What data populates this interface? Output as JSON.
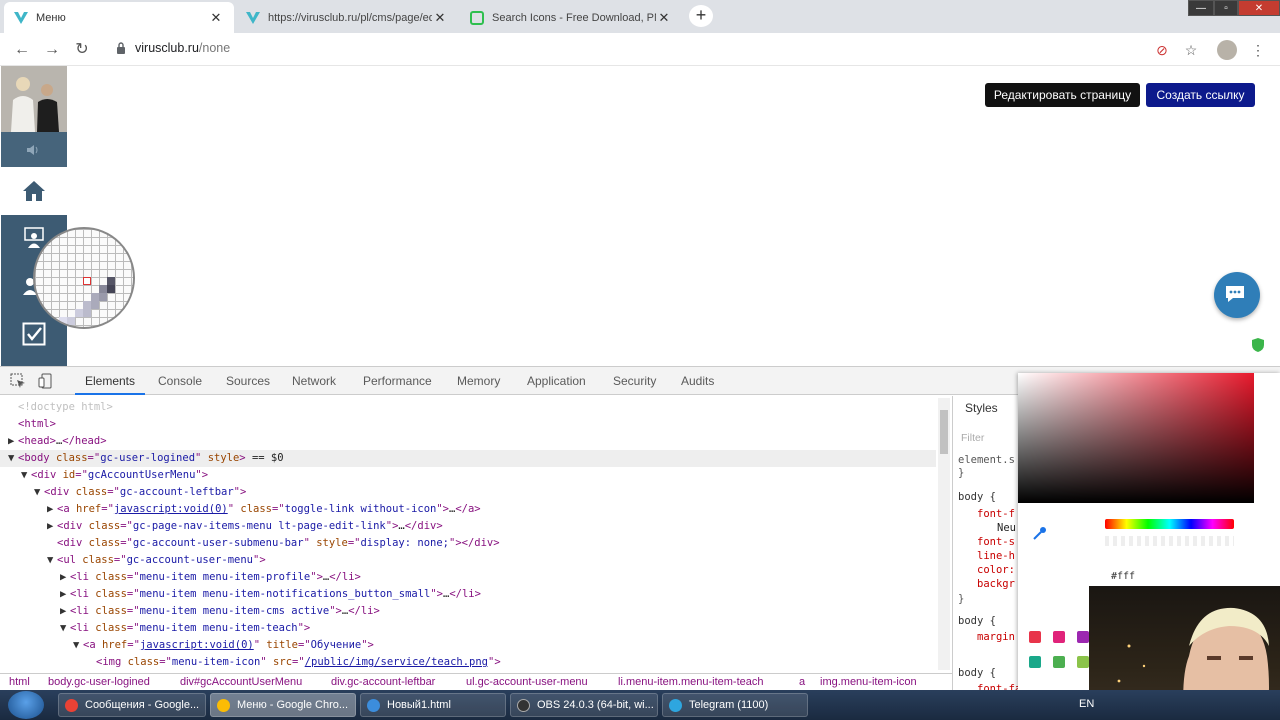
{
  "browser": {
    "tabs": [
      {
        "title": "Меню",
        "active": true
      },
      {
        "title": "https://virusclub.ru/pl/cms/page/ed",
        "active": false
      },
      {
        "title": "Search Icons - Free Download, PNG",
        "active": false
      }
    ],
    "newtab": "+",
    "close_glyph": "✕",
    "url_host": "virusclub.ru",
    "url_path": "/none"
  },
  "page": {
    "edit_button": "Редактировать страницу",
    "create_link_button": "Создать ссылку"
  },
  "devtools": {
    "tabs": [
      "Elements",
      "Console",
      "Sources",
      "Network",
      "Performance",
      "Memory",
      "Application",
      "Security",
      "Audits"
    ],
    "active_tab": "Elements",
    "dom_lines": [
      {
        "indent": 1,
        "tri": "",
        "parts": [
          [
            "doctype",
            "<!doctype html>"
          ]
        ]
      },
      {
        "indent": 1,
        "tri": "",
        "parts": [
          [
            "tag",
            "<html>"
          ]
        ]
      },
      {
        "indent": 1,
        "tri": "▶",
        "parts": [
          [
            "tag",
            "<head>"
          ],
          [
            "txt",
            "…"
          ],
          [
            "tag",
            "</head>"
          ]
        ]
      },
      {
        "indent": 1,
        "tri": "▼",
        "sel": true,
        "parts": [
          [
            "tag",
            "<body "
          ],
          [
            "attr",
            "class"
          ],
          [
            "tag",
            "=\""
          ],
          [
            "val",
            "gc-user-logined"
          ],
          [
            "tag",
            "\" "
          ],
          [
            "attr",
            "style"
          ],
          [
            "tag",
            ">"
          ],
          [
            "txt",
            " == $0"
          ]
        ]
      },
      {
        "indent": 2,
        "tri": "▼",
        "parts": [
          [
            "tag",
            "<div "
          ],
          [
            "attr",
            "id"
          ],
          [
            "tag",
            "=\""
          ],
          [
            "val",
            "gcAccountUserMenu"
          ],
          [
            "tag",
            "\">"
          ]
        ]
      },
      {
        "indent": 3,
        "tri": "▼",
        "parts": [
          [
            "tag",
            "<div "
          ],
          [
            "attr",
            "class"
          ],
          [
            "tag",
            "=\""
          ],
          [
            "val",
            "gc-account-leftbar"
          ],
          [
            "tag",
            "\">"
          ]
        ]
      },
      {
        "indent": 4,
        "tri": "▶",
        "parts": [
          [
            "tag",
            "<a "
          ],
          [
            "attr",
            "href"
          ],
          [
            "tag",
            "=\""
          ],
          [
            "lnk",
            "javascript:void(0)"
          ],
          [
            "tag",
            "\" "
          ],
          [
            "attr",
            "class"
          ],
          [
            "tag",
            "=\""
          ],
          [
            "val",
            "toggle-link without-icon"
          ],
          [
            "tag",
            "\">"
          ],
          [
            "txt",
            "…"
          ],
          [
            "tag",
            "</a>"
          ]
        ]
      },
      {
        "indent": 4,
        "tri": "▶",
        "parts": [
          [
            "tag",
            "<div "
          ],
          [
            "attr",
            "class"
          ],
          [
            "tag",
            "=\""
          ],
          [
            "val",
            "gc-page-nav-items-menu lt-page-edit-link"
          ],
          [
            "tag",
            "\">"
          ],
          [
            "txt",
            "…"
          ],
          [
            "tag",
            "</div>"
          ]
        ]
      },
      {
        "indent": 4,
        "tri": "",
        "parts": [
          [
            "tag",
            "<div "
          ],
          [
            "attr",
            "class"
          ],
          [
            "tag",
            "=\""
          ],
          [
            "val",
            "gc-account-user-submenu-bar"
          ],
          [
            "tag",
            "\" "
          ],
          [
            "attr",
            "style"
          ],
          [
            "tag",
            "=\""
          ],
          [
            "val",
            "display: none;"
          ],
          [
            "tag",
            "\"></div>"
          ]
        ]
      },
      {
        "indent": 4,
        "tri": "▼",
        "parts": [
          [
            "tag",
            "<ul "
          ],
          [
            "attr",
            "class"
          ],
          [
            "tag",
            "=\""
          ],
          [
            "val",
            "gc-account-user-menu"
          ],
          [
            "tag",
            "\">"
          ]
        ]
      },
      {
        "indent": 5,
        "tri": "▶",
        "parts": [
          [
            "tag",
            "<li "
          ],
          [
            "attr",
            "class"
          ],
          [
            "tag",
            "=\""
          ],
          [
            "val",
            "menu-item menu-item-profile"
          ],
          [
            "tag",
            "\">"
          ],
          [
            "txt",
            "…"
          ],
          [
            "tag",
            "</li>"
          ]
        ]
      },
      {
        "indent": 5,
        "tri": "▶",
        "parts": [
          [
            "tag",
            "<li "
          ],
          [
            "attr",
            "class"
          ],
          [
            "tag",
            "=\""
          ],
          [
            "val",
            "menu-item menu-item-notifications_button_small"
          ],
          [
            "tag",
            "\">"
          ],
          [
            "txt",
            "…"
          ],
          [
            "tag",
            "</li>"
          ]
        ]
      },
      {
        "indent": 5,
        "tri": "▶",
        "parts": [
          [
            "tag",
            "<li "
          ],
          [
            "attr",
            "class"
          ],
          [
            "tag",
            "=\""
          ],
          [
            "val",
            "menu-item menu-item-cms active"
          ],
          [
            "tag",
            "\">"
          ],
          [
            "txt",
            "…"
          ],
          [
            "tag",
            "</li>"
          ]
        ]
      },
      {
        "indent": 5,
        "tri": "▼",
        "parts": [
          [
            "tag",
            "<li "
          ],
          [
            "attr",
            "class"
          ],
          [
            "tag",
            "=\""
          ],
          [
            "val",
            "menu-item menu-item-teach"
          ],
          [
            "tag",
            "\">"
          ]
        ]
      },
      {
        "indent": 6,
        "tri": "▼",
        "parts": [
          [
            "tag",
            "<a "
          ],
          [
            "attr",
            "href"
          ],
          [
            "tag",
            "=\""
          ],
          [
            "lnk",
            "javascript:void(0)"
          ],
          [
            "tag",
            "\" "
          ],
          [
            "attr",
            "title"
          ],
          [
            "tag",
            "=\""
          ],
          [
            "val",
            "Обучение"
          ],
          [
            "tag",
            "\">"
          ]
        ]
      },
      {
        "indent": 7,
        "tri": "",
        "parts": [
          [
            "tag",
            "<img "
          ],
          [
            "attr",
            "class"
          ],
          [
            "tag",
            "=\""
          ],
          [
            "val",
            "menu-item-icon"
          ],
          [
            "tag",
            "\" "
          ],
          [
            "attr",
            "src"
          ],
          [
            "tag",
            "=\""
          ],
          [
            "lnk",
            "/public/img/service/teach.png"
          ],
          [
            "tag",
            "\">"
          ]
        ]
      }
    ],
    "breadcrumbs": [
      "html",
      "body.gc-user-logined",
      "div#gcAccountUserMenu",
      "div.gc-account-leftbar",
      "ul.gc-account-user-menu",
      "li.menu-item.menu-item-teach",
      "a",
      "img.menu-item-icon"
    ],
    "styles": {
      "tab": "Styles",
      "filter": "Filter",
      "element_style": "element.s",
      "brace_close": "}",
      "rules": [
        {
          "selector": "body {",
          "props": [
            "font-f",
            "Neu",
            "font-s",
            "line-h",
            "color:",
            "backgr"
          ]
        },
        {
          "selector": "body {",
          "props": [
            "margin"
          ]
        },
        {
          "selector": "body {",
          "props": [
            "font-family: \"He"
          ]
        }
      ]
    },
    "color_picker": {
      "hex": "#fff",
      "swatches": [
        "#e8344a",
        "#e0237a",
        "#9c27b0",
        "#1aa88a",
        "#4caf50",
        "#8bc34a"
      ]
    }
  },
  "taskbar": {
    "items": [
      {
        "label": "Сообщения - Google...",
        "active": false,
        "color": "#e94235"
      },
      {
        "label": "Меню - Google Chro...",
        "active": true,
        "color": "#fbbc05"
      },
      {
        "label": "Новый1.html",
        "active": false,
        "color": "#3c8ddc"
      },
      {
        "label": "OBS 24.0.3 (64-bit, wi...",
        "active": false,
        "color": "#333"
      },
      {
        "label": "Telegram (1100)",
        "active": false,
        "color": "#2ea6df"
      }
    ],
    "lang": "EN"
  }
}
